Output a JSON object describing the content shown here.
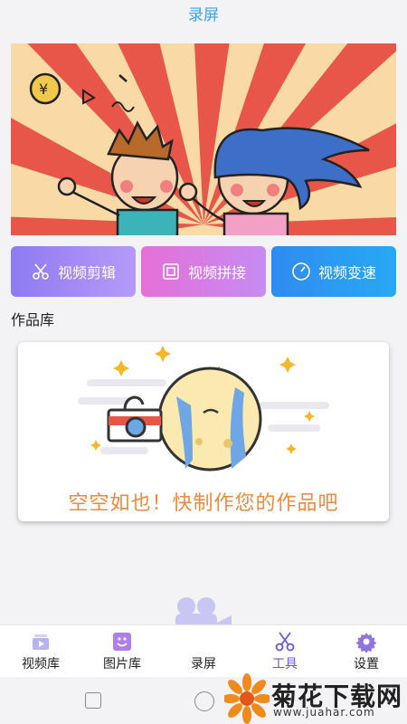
{
  "header": {
    "title": "录屏"
  },
  "tools": {
    "cut_label": "视频剪辑",
    "join_label": "视频拼接",
    "speed_label": "视频变速"
  },
  "works": {
    "section_title": "作品库",
    "empty_text": "空空如也！快制作您的作品吧"
  },
  "tabbar": {
    "items": [
      {
        "label": "视频库",
        "icon": "video-library-icon"
      },
      {
        "label": "图片库",
        "icon": "image-library-icon"
      },
      {
        "label": "录屏",
        "icon": "screen-record-icon"
      },
      {
        "label": "工具",
        "icon": "scissors-icon",
        "active": true
      },
      {
        "label": "设置",
        "icon": "gear-icon"
      }
    ]
  },
  "watermark": {
    "title": "菊花下载网",
    "url": "www.juahar.com"
  },
  "colors": {
    "accent": "#6a55e0",
    "header": "#3aa3e8",
    "empty_text": "#f08a3c"
  }
}
